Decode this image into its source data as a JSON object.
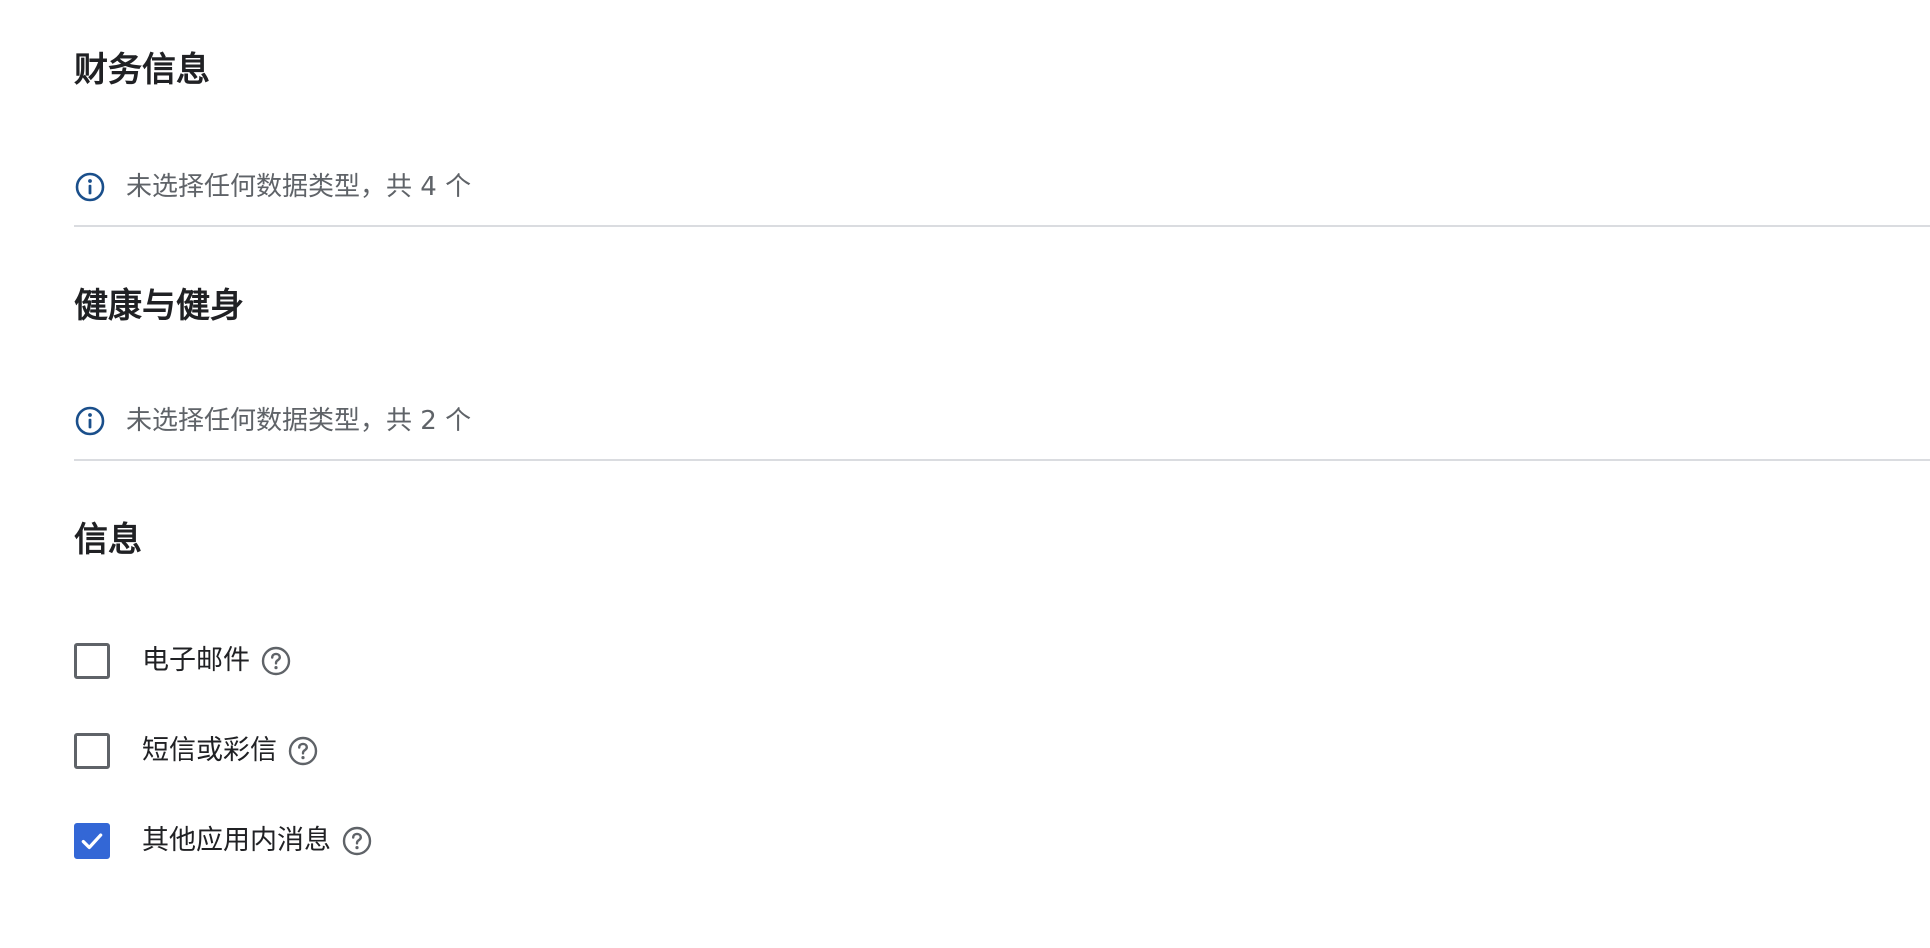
{
  "sections": [
    {
      "title": "财务信息",
      "info_text": "未选择任何数据类型，共 4 个"
    },
    {
      "title": "健康与健身",
      "info_text": "未选择任何数据类型，共 2 个"
    },
    {
      "title": "信息",
      "options": [
        {
          "label": "电子邮件",
          "checked": false
        },
        {
          "label": "短信或彩信",
          "checked": false
        },
        {
          "label": "其他应用内消息",
          "checked": true
        }
      ]
    }
  ],
  "icons": {
    "info": "info-icon",
    "help": "help-circle-icon",
    "check": "check-icon"
  },
  "colors": {
    "info_icon": "#1a4f8b",
    "checkbox_checked": "#3367d6",
    "checkbox_border": "#5f6368",
    "divider": "#dadce0"
  }
}
